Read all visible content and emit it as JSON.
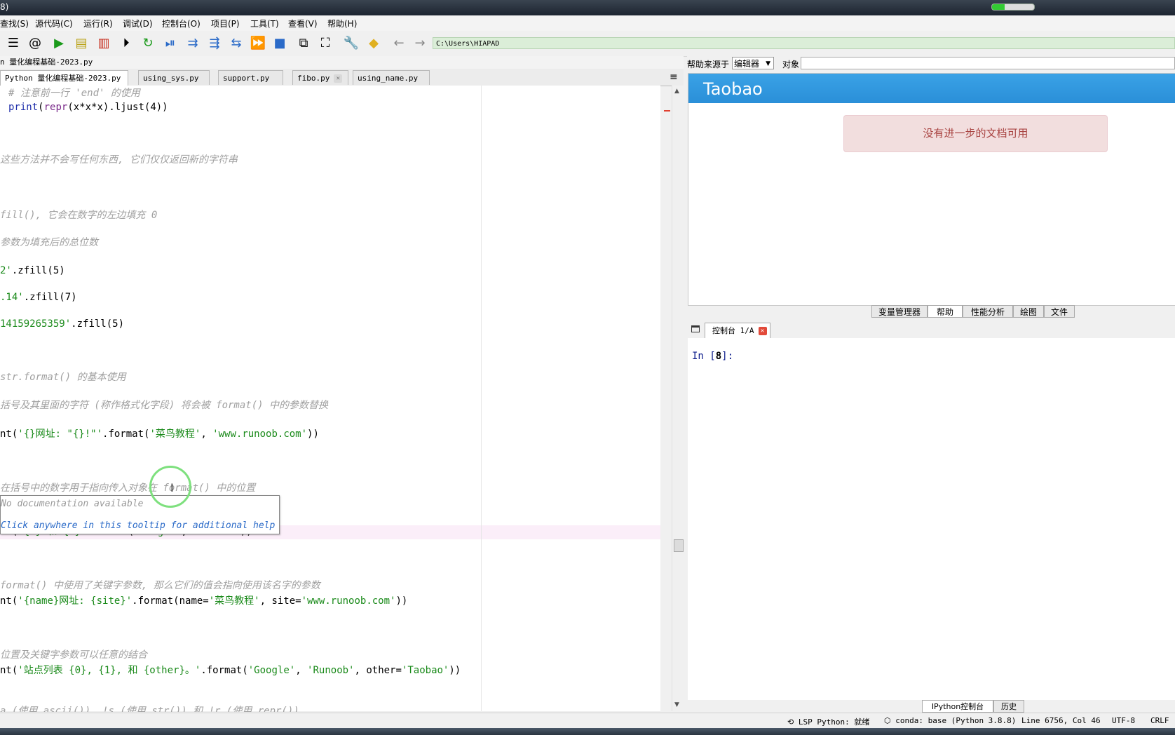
{
  "window": {
    "title_fragment": "8)"
  },
  "menu": [
    "查找(S)",
    "源代码(C)",
    "运行(R)",
    "调试(D)",
    "控制台(O)",
    "项目(P)",
    "工具(T)",
    "查看(V)",
    "帮助(H)"
  ],
  "toolbar": {
    "path": "C:\\Users\\HIAPAD"
  },
  "editor": {
    "filepath": "n 量化编程基础-2023.py",
    "tabs": [
      {
        "label": "Python 量化编程基础-2023.py",
        "active": true
      },
      {
        "label": "using_sys.py",
        "active": false
      },
      {
        "label": "support.py",
        "active": false
      },
      {
        "label": "fibo.py",
        "active": false
      },
      {
        "label": "using_name.py",
        "active": false
      }
    ],
    "code": {
      "l1": "# 注意前一行 'end' 的使用",
      "l2a": "print",
      "l2b": "(",
      "l2c": "repr",
      "l2d": "(x*x*x).ljust(4))",
      "l3": "这些方法并不会写任何东西, 它们仅仅返回新的字符串",
      "l4": "fill(), 它会在数字的左边填充 0",
      "l5": "参数为填充后的总位数",
      "l6a": "2'",
      "l6b": ".zfill(5)",
      "l7a": ".14'",
      "l7b": ".zfill(7)",
      "l8a": "14159265359'",
      "l8b": ".zfill(5)",
      "l9": "str.format() 的基本使用",
      "l10": "括号及其里面的字符 (称作格式化字段) 将会被 format() 中的参数替换",
      "l11a": "nt(",
      "l11b": "'{}网址: \"{}!\"'",
      "l11c": ".format(",
      "l11d": "'菜鸟教程'",
      "l11e": ", ",
      "l11f": "'www.runoob.com'",
      "l11g": "))",
      "l12": "在括号中的数字用于指向传入对象在 format() 中的位置",
      "l13a": "nt(",
      "l13b": "'{1} 和 {0}'",
      "l13c": ".format(",
      "l13d": "'Google'",
      "l13e": ", ",
      "l13f": "'Runoob'",
      "l13g": "))",
      "l14": "format() 中使用了关键字参数, 那么它们的值会指向使用该名字的参数",
      "l15a": "nt(",
      "l15b": "'{name}网址: {site}'",
      "l15c": ".format(name=",
      "l15d": "'菜鸟教程'",
      "l15e": ", site=",
      "l15f": "'www.runoob.com'",
      "l15g": "))",
      "l16": "位置及关键字参数可以任意的结合",
      "l17a": "nt(",
      "l17b": "'站点列表 {0}, {1}, 和 {other}。'",
      "l17c": ".format(",
      "l17d": "'Google'",
      "l17e": ", ",
      "l17f": "'Runoob'",
      "l17g": ", other=",
      "l17h": "'Taobao'",
      "l17i": "))",
      "l18": "a (使用 ascii()), !s (使用 str()) 和 !r (使用 repr())"
    },
    "tooltip": {
      "line1": "No documentation available",
      "line2": "Click anywhere in this tooltip for additional help"
    }
  },
  "help": {
    "source_label": "帮助来源于",
    "source_value": "编辑器",
    "object_label": "对象",
    "header": "Taobao",
    "alert": "没有进一步的文档可用"
  },
  "panel_tabs": [
    "变量管理器",
    "帮助",
    "性能分析",
    "绘图",
    "文件"
  ],
  "console": {
    "tab_label": "控制台 1/A",
    "prompt_in": "In [",
    "prompt_num": "8",
    "prompt_end": "]:"
  },
  "bottom_tabs": [
    "IPython控制台",
    "历史"
  ],
  "status": {
    "lsp": "LSP Python: 就绪",
    "conda": "conda: base (Python 3.8.8)",
    "position": "Line 6756, Col 46",
    "encoding": "UTF-8",
    "eol": "CRLF"
  },
  "colors": {
    "accent_blue": "#2a8fd8",
    "alert_text": "#a94442",
    "string_green": "#1a8a1a",
    "comment_gray": "#a0a0a0"
  }
}
